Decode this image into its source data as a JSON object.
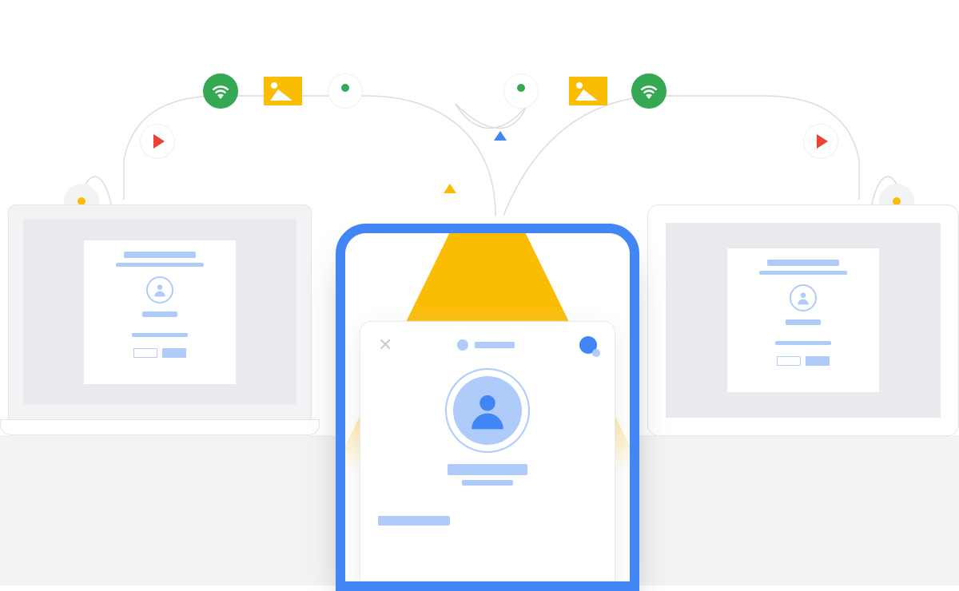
{
  "diagram": {
    "description": "Cross-device account sync illustration: laptop, phone, tablet connected via a flow of content nodes",
    "devices": {
      "laptop": "laptop-login-screen",
      "phone": "phone-account-sheet",
      "tablet": "tablet-login-screen"
    },
    "flow_icons": [
      "location-pin",
      "play-video",
      "wifi",
      "photo",
      "user-presence",
      "user-presence",
      "photo",
      "wifi",
      "play-video",
      "location-pin"
    ],
    "colors": {
      "blue": "#4285f4",
      "light_blue": "#aecbfa",
      "green": "#34a853",
      "yellow": "#fbbc04",
      "red": "#ea4335",
      "grey_bg": "#f1f3f4",
      "grey_panel": "#e8eaed"
    }
  }
}
